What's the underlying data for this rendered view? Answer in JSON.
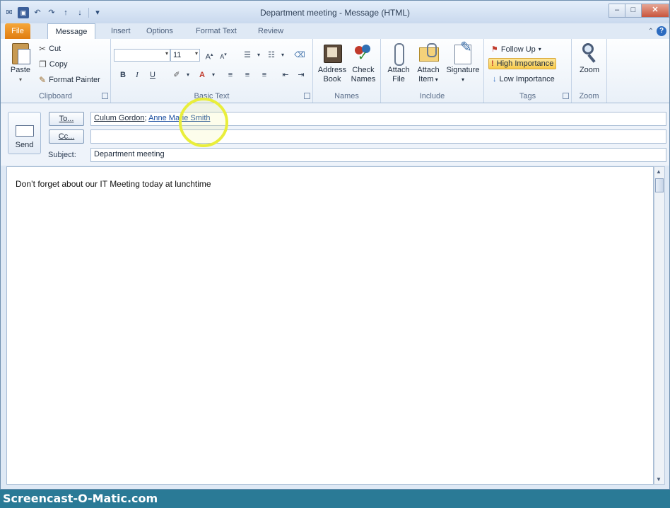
{
  "window": {
    "title": "Department meeting - Message (HTML)"
  },
  "window_controls": {
    "minimize": "–",
    "maximize": "□",
    "close": "✕"
  },
  "tabs": [
    {
      "label": "File"
    },
    {
      "label": "Message"
    },
    {
      "label": "Insert"
    },
    {
      "label": "Options"
    },
    {
      "label": "Format Text"
    },
    {
      "label": "Review"
    }
  ],
  "ribbon": {
    "clipboard": {
      "label": "Clipboard",
      "paste": "Paste",
      "cut": "Cut",
      "copy": "Copy",
      "format_painter": "Format Painter"
    },
    "basic_text": {
      "label": "Basic Text",
      "font_size": "11",
      "bold": "B",
      "italic": "I",
      "underline": "U"
    },
    "names": {
      "label": "Names",
      "address_book_1": "Address",
      "address_book_2": "Book",
      "check_names_1": "Check",
      "check_names_2": "Names"
    },
    "include": {
      "label": "Include",
      "attach_file_1": "Attach",
      "attach_file_2": "File",
      "attach_item_1": "Attach",
      "attach_item_2": "Item",
      "signature": "Signature"
    },
    "tags": {
      "label": "Tags",
      "follow_up": "Follow Up",
      "high_importance": "High Importance",
      "low_importance": "Low Importance"
    },
    "zoom": {
      "label": "Zoom",
      "zoom": "Zoom"
    }
  },
  "header": {
    "send": "Send",
    "to_button": "To...",
    "cc_button": "Cc...",
    "subject_label": "Subject:",
    "to_recipient_1": "Culum Gordon",
    "to_separator": ";",
    "to_recipient_2": "Anne Marie Smith",
    "cc_value": "",
    "subject_value": "Department meeting"
  },
  "body": {
    "text": "Don’t forget about our IT Meeting today at lunchtime"
  },
  "watermark": "Screencast-O-Matic.com",
  "colors": {
    "file_tab": "#e8861a",
    "accent": "#2b6bc0",
    "highlight": "#e9ee3b"
  }
}
